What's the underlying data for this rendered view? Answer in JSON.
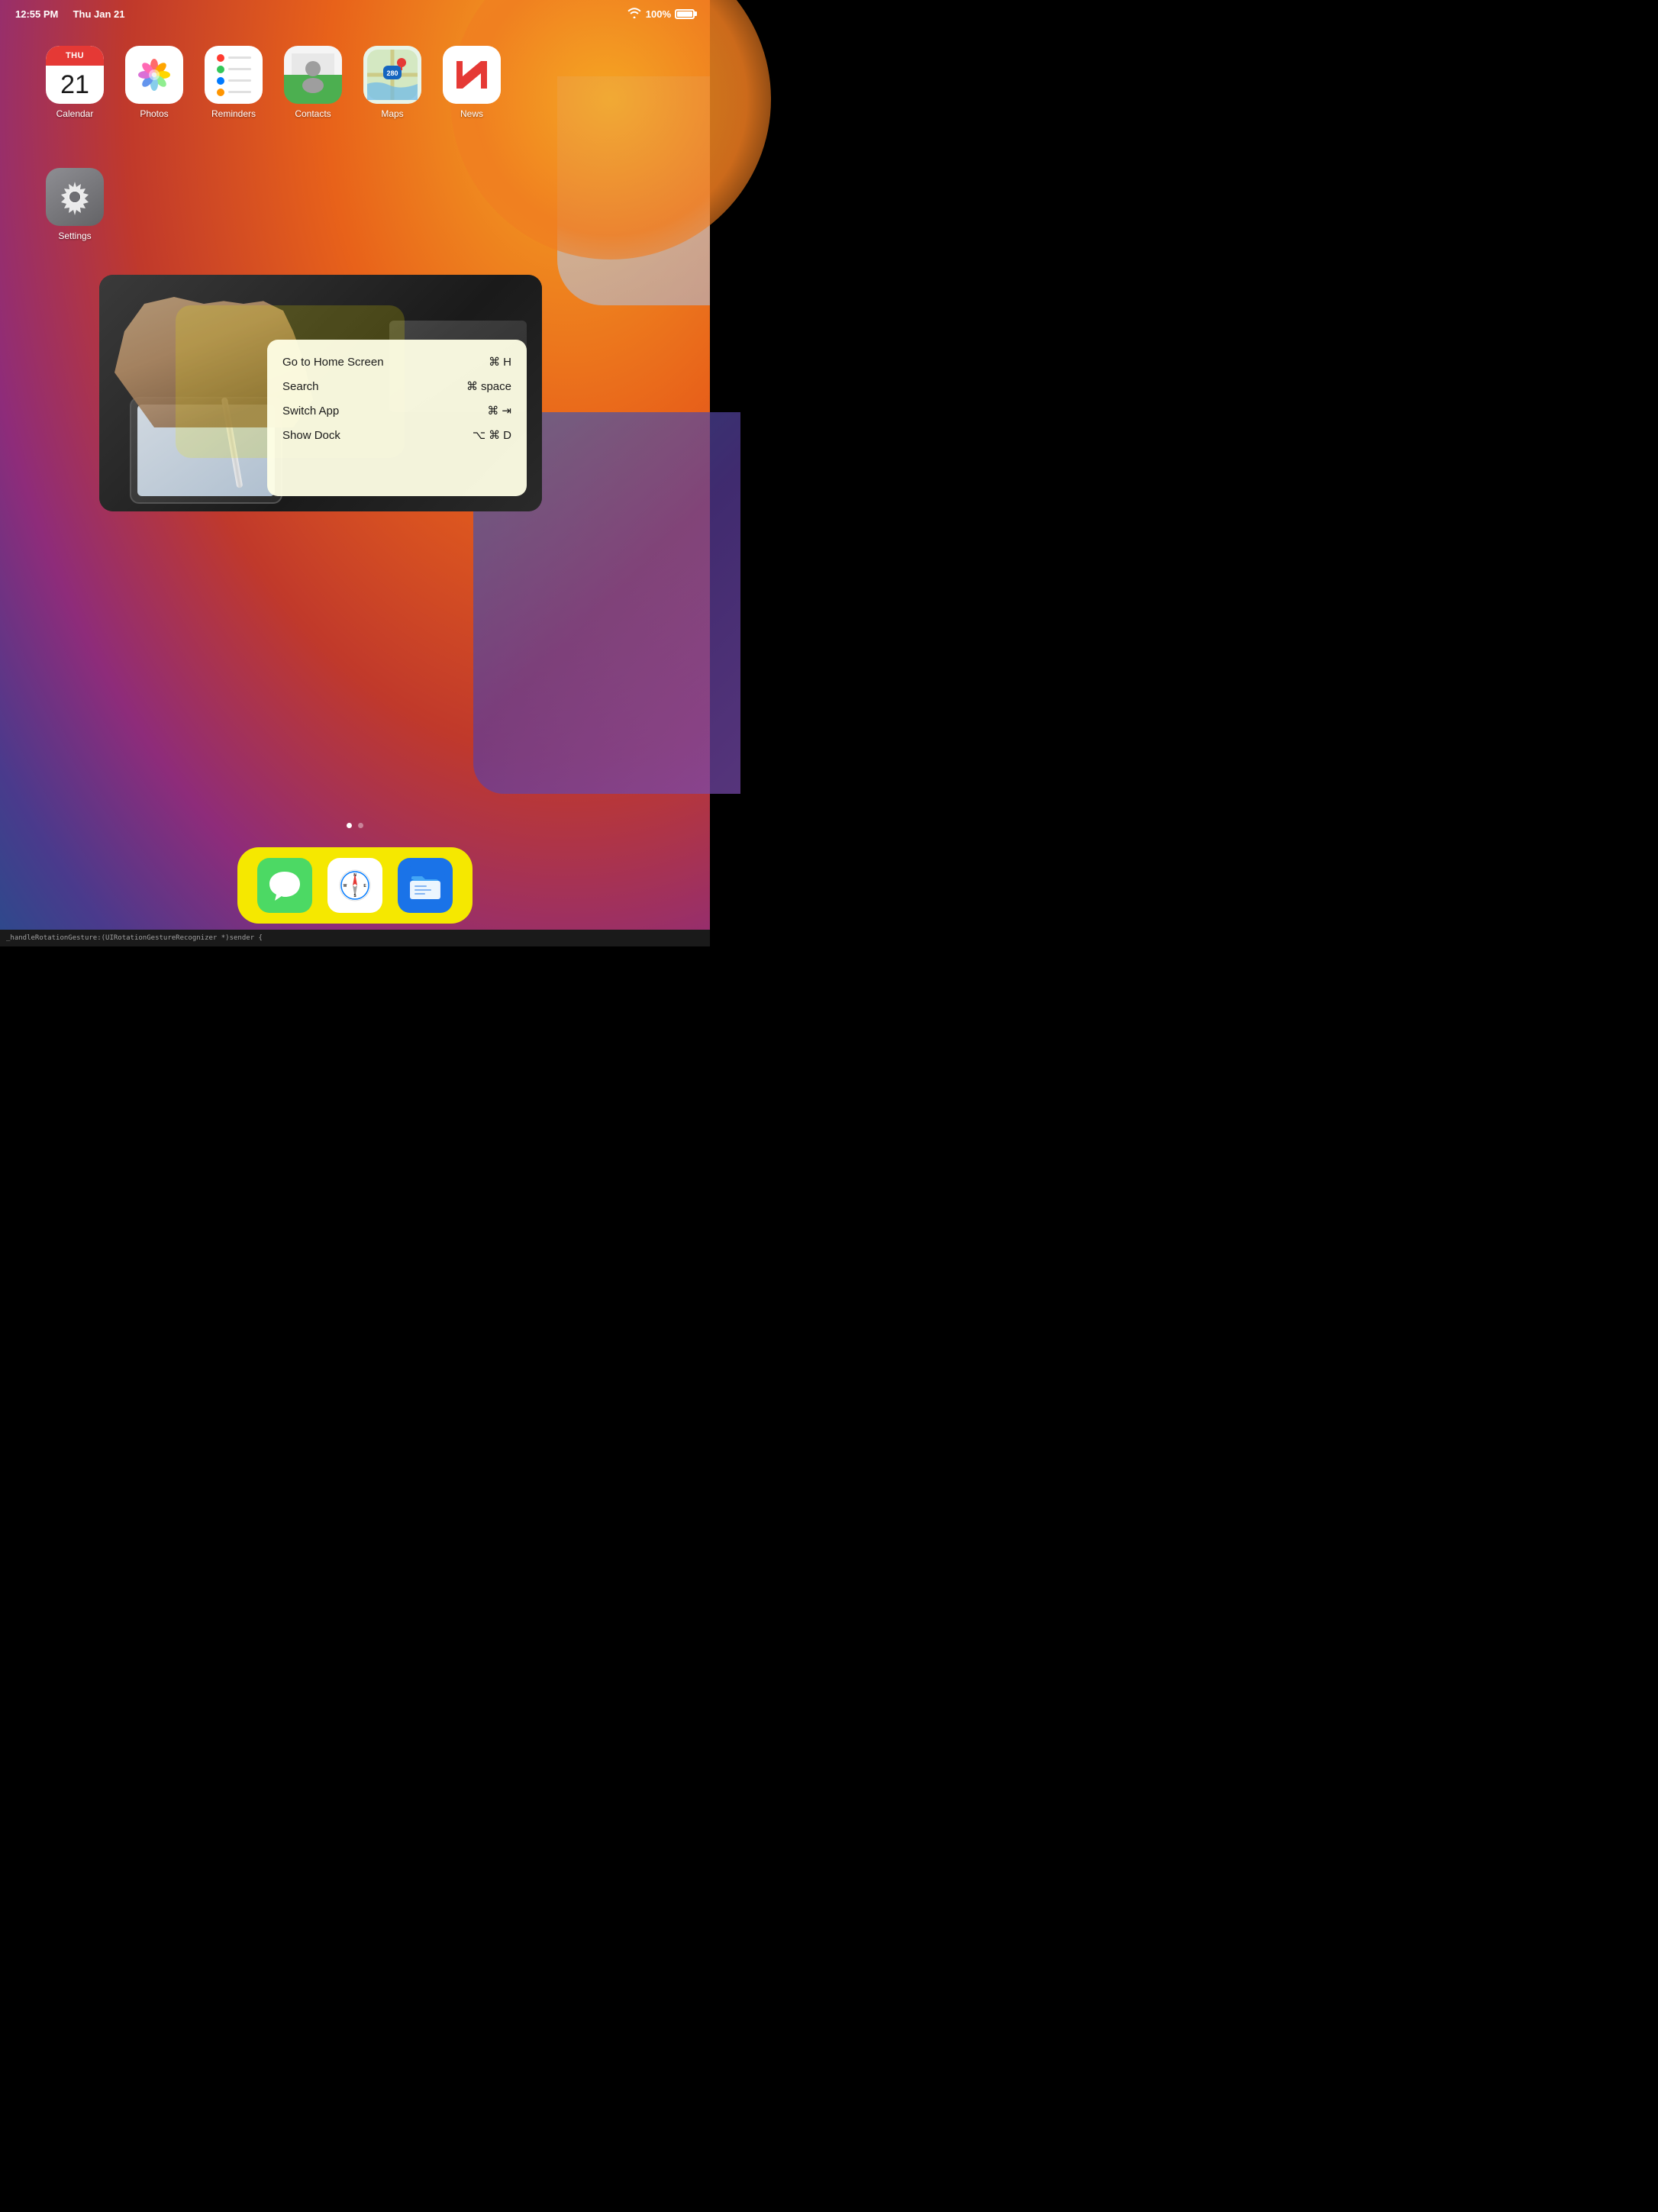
{
  "status_bar": {
    "time": "12:55 PM",
    "date": "Thu Jan 21",
    "battery_percent": "100%",
    "wifi": true
  },
  "apps": {
    "row1": [
      {
        "id": "calendar",
        "label": "Calendar",
        "day_label": "THU",
        "day_number": "21"
      },
      {
        "id": "photos",
        "label": "Photos"
      },
      {
        "id": "reminders",
        "label": "Reminders"
      },
      {
        "id": "contacts",
        "label": "Contacts"
      },
      {
        "id": "maps",
        "label": "Maps"
      },
      {
        "id": "news",
        "label": "News"
      }
    ],
    "row2": [
      {
        "id": "settings",
        "label": "Settings"
      }
    ]
  },
  "shortcut_overlay": {
    "shortcuts": [
      {
        "label": "Go to Home Screen",
        "key1": "⌘",
        "key2": "H"
      },
      {
        "label": "Search",
        "key1": "⌘",
        "key2": "space"
      },
      {
        "label": "Switch App",
        "key1": "⌘",
        "key2": "⇥"
      },
      {
        "label": "Show Dock",
        "key1": "⌥",
        "key2": "⌘",
        "key3": "D"
      }
    ]
  },
  "dock": {
    "apps": [
      {
        "id": "messages",
        "label": "Messages"
      },
      {
        "id": "safari",
        "label": "Safari"
      },
      {
        "id": "files",
        "label": "Files"
      }
    ]
  },
  "page_indicators": {
    "total": 2,
    "active": 0
  },
  "debug_bar": {
    "text": "_handleRotationGesture:(UIRotationGestureRecognizer *)sender {"
  }
}
